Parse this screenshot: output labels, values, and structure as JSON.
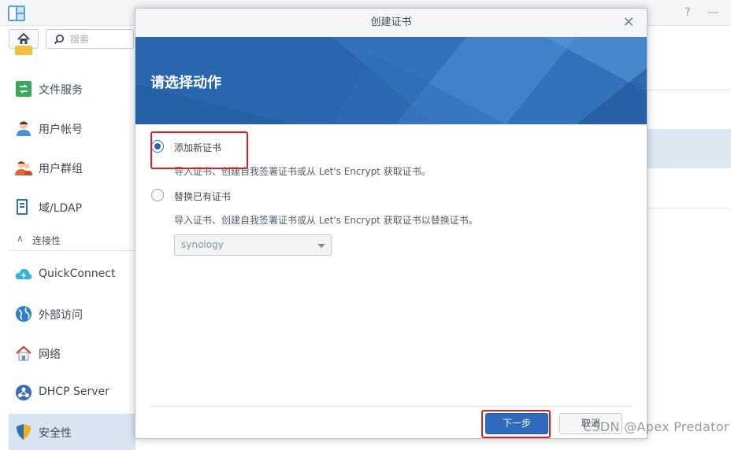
{
  "window": {
    "help_icon": "question-mark",
    "minimize_icon": "minimize"
  },
  "toolbar": {
    "search_placeholder": "搜索"
  },
  "sidebar": {
    "items": [
      {
        "label": "文件服务",
        "icon": "file-services-icon"
      },
      {
        "label": "用户帐号",
        "icon": "user-icon"
      },
      {
        "label": "用户群组",
        "icon": "group-icon"
      },
      {
        "label": "域/LDAP",
        "icon": "domain-icon"
      },
      {
        "label": "QuickConnect",
        "icon": "quickconnect-icon"
      },
      {
        "label": "外部访问",
        "icon": "external-access-icon"
      },
      {
        "label": "网络",
        "icon": "network-icon"
      },
      {
        "label": "DHCP Server",
        "icon": "dhcp-icon"
      },
      {
        "label": "安全性",
        "icon": "security-icon",
        "active": true
      }
    ],
    "section_connectivity": "连接性"
  },
  "dialog": {
    "title": "创建证书",
    "banner_title": "请选择动作",
    "options": [
      {
        "label": "添加新证书",
        "description": "导入证书、创建自我签署证书或从 Let's Encrypt 获取证书。",
        "selected": true
      },
      {
        "label": "替换已有证书",
        "description": "导入证书、创建自我签署证书或从 Let's Encrypt 获取证书以替换证书。",
        "selected": false
      }
    ],
    "certificate_select": {
      "value": "synology"
    },
    "next_button": "下一步",
    "cancel_button": "取消"
  },
  "watermark": "CSDN @Apex   Predator",
  "colors": {
    "accent": "#2e6bbf",
    "banner": "#2763a8",
    "highlight_box": "#e02020",
    "active_nav": "#d8e4f1"
  }
}
